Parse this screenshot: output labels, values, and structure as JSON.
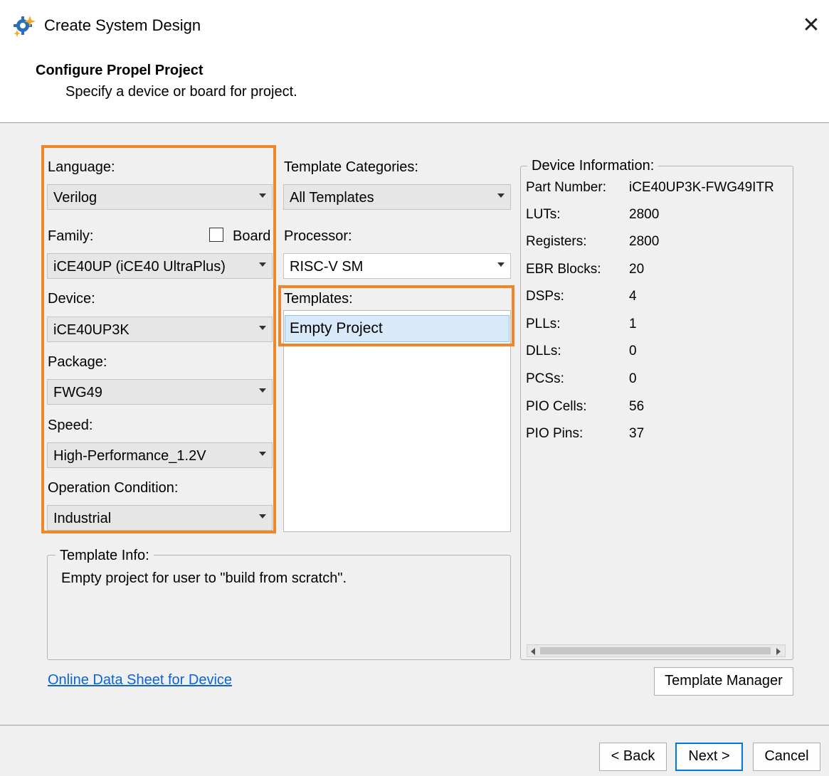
{
  "window": {
    "title": "Create System Design",
    "close_glyph": "✕"
  },
  "header": {
    "title": "Configure Propel Project",
    "subtitle": "Specify a device or board for project."
  },
  "left": {
    "language_label": "Language:",
    "language_value": "Verilog",
    "family_label": "Family:",
    "board_label": "Board",
    "family_value": "iCE40UP (iCE40 UltraPlus)",
    "device_label": "Device:",
    "device_value": "iCE40UP3K",
    "package_label": "Package:",
    "package_value": "FWG49",
    "speed_label": "Speed:",
    "speed_value": "High-Performance_1.2V",
    "opcond_label": "Operation Condition:",
    "opcond_value": "Industrial"
  },
  "middle": {
    "categories_label": "Template Categories:",
    "categories_value": "All Templates",
    "processor_label": "Processor:",
    "processor_value": "RISC-V SM",
    "templates_label": "Templates:",
    "templates": [
      "Empty Project"
    ]
  },
  "device_info": {
    "legend": "Device Information:",
    "rows": [
      {
        "label": "Part Number:",
        "value": "iCE40UP3K-FWG49ITR"
      },
      {
        "label": "LUTs:",
        "value": "2800"
      },
      {
        "label": "Registers:",
        "value": "2800"
      },
      {
        "label": "EBR Blocks:",
        "value": "20"
      },
      {
        "label": "DSPs:",
        "value": "4"
      },
      {
        "label": "PLLs:",
        "value": "1"
      },
      {
        "label": "DLLs:",
        "value": "0"
      },
      {
        "label": "PCSs:",
        "value": "0"
      },
      {
        "label": "PIO Cells:",
        "value": "56"
      },
      {
        "label": "PIO Pins:",
        "value": "37"
      }
    ]
  },
  "template_info": {
    "legend": "Template Info:",
    "text": "Empty project for user to \"build from scratch\"."
  },
  "link_text": "Online Data Sheet for Device",
  "buttons": {
    "template_manager": "Template Manager",
    "back": "< Back",
    "next": "Next >",
    "cancel": "Cancel"
  },
  "colors": {
    "highlight": "#f0862a",
    "link": "#0a64d6",
    "selection": "#d8eaf9"
  },
  "icons": {
    "app": "gear-sparkle-icon",
    "dropdown": "chevron-down-icon"
  }
}
